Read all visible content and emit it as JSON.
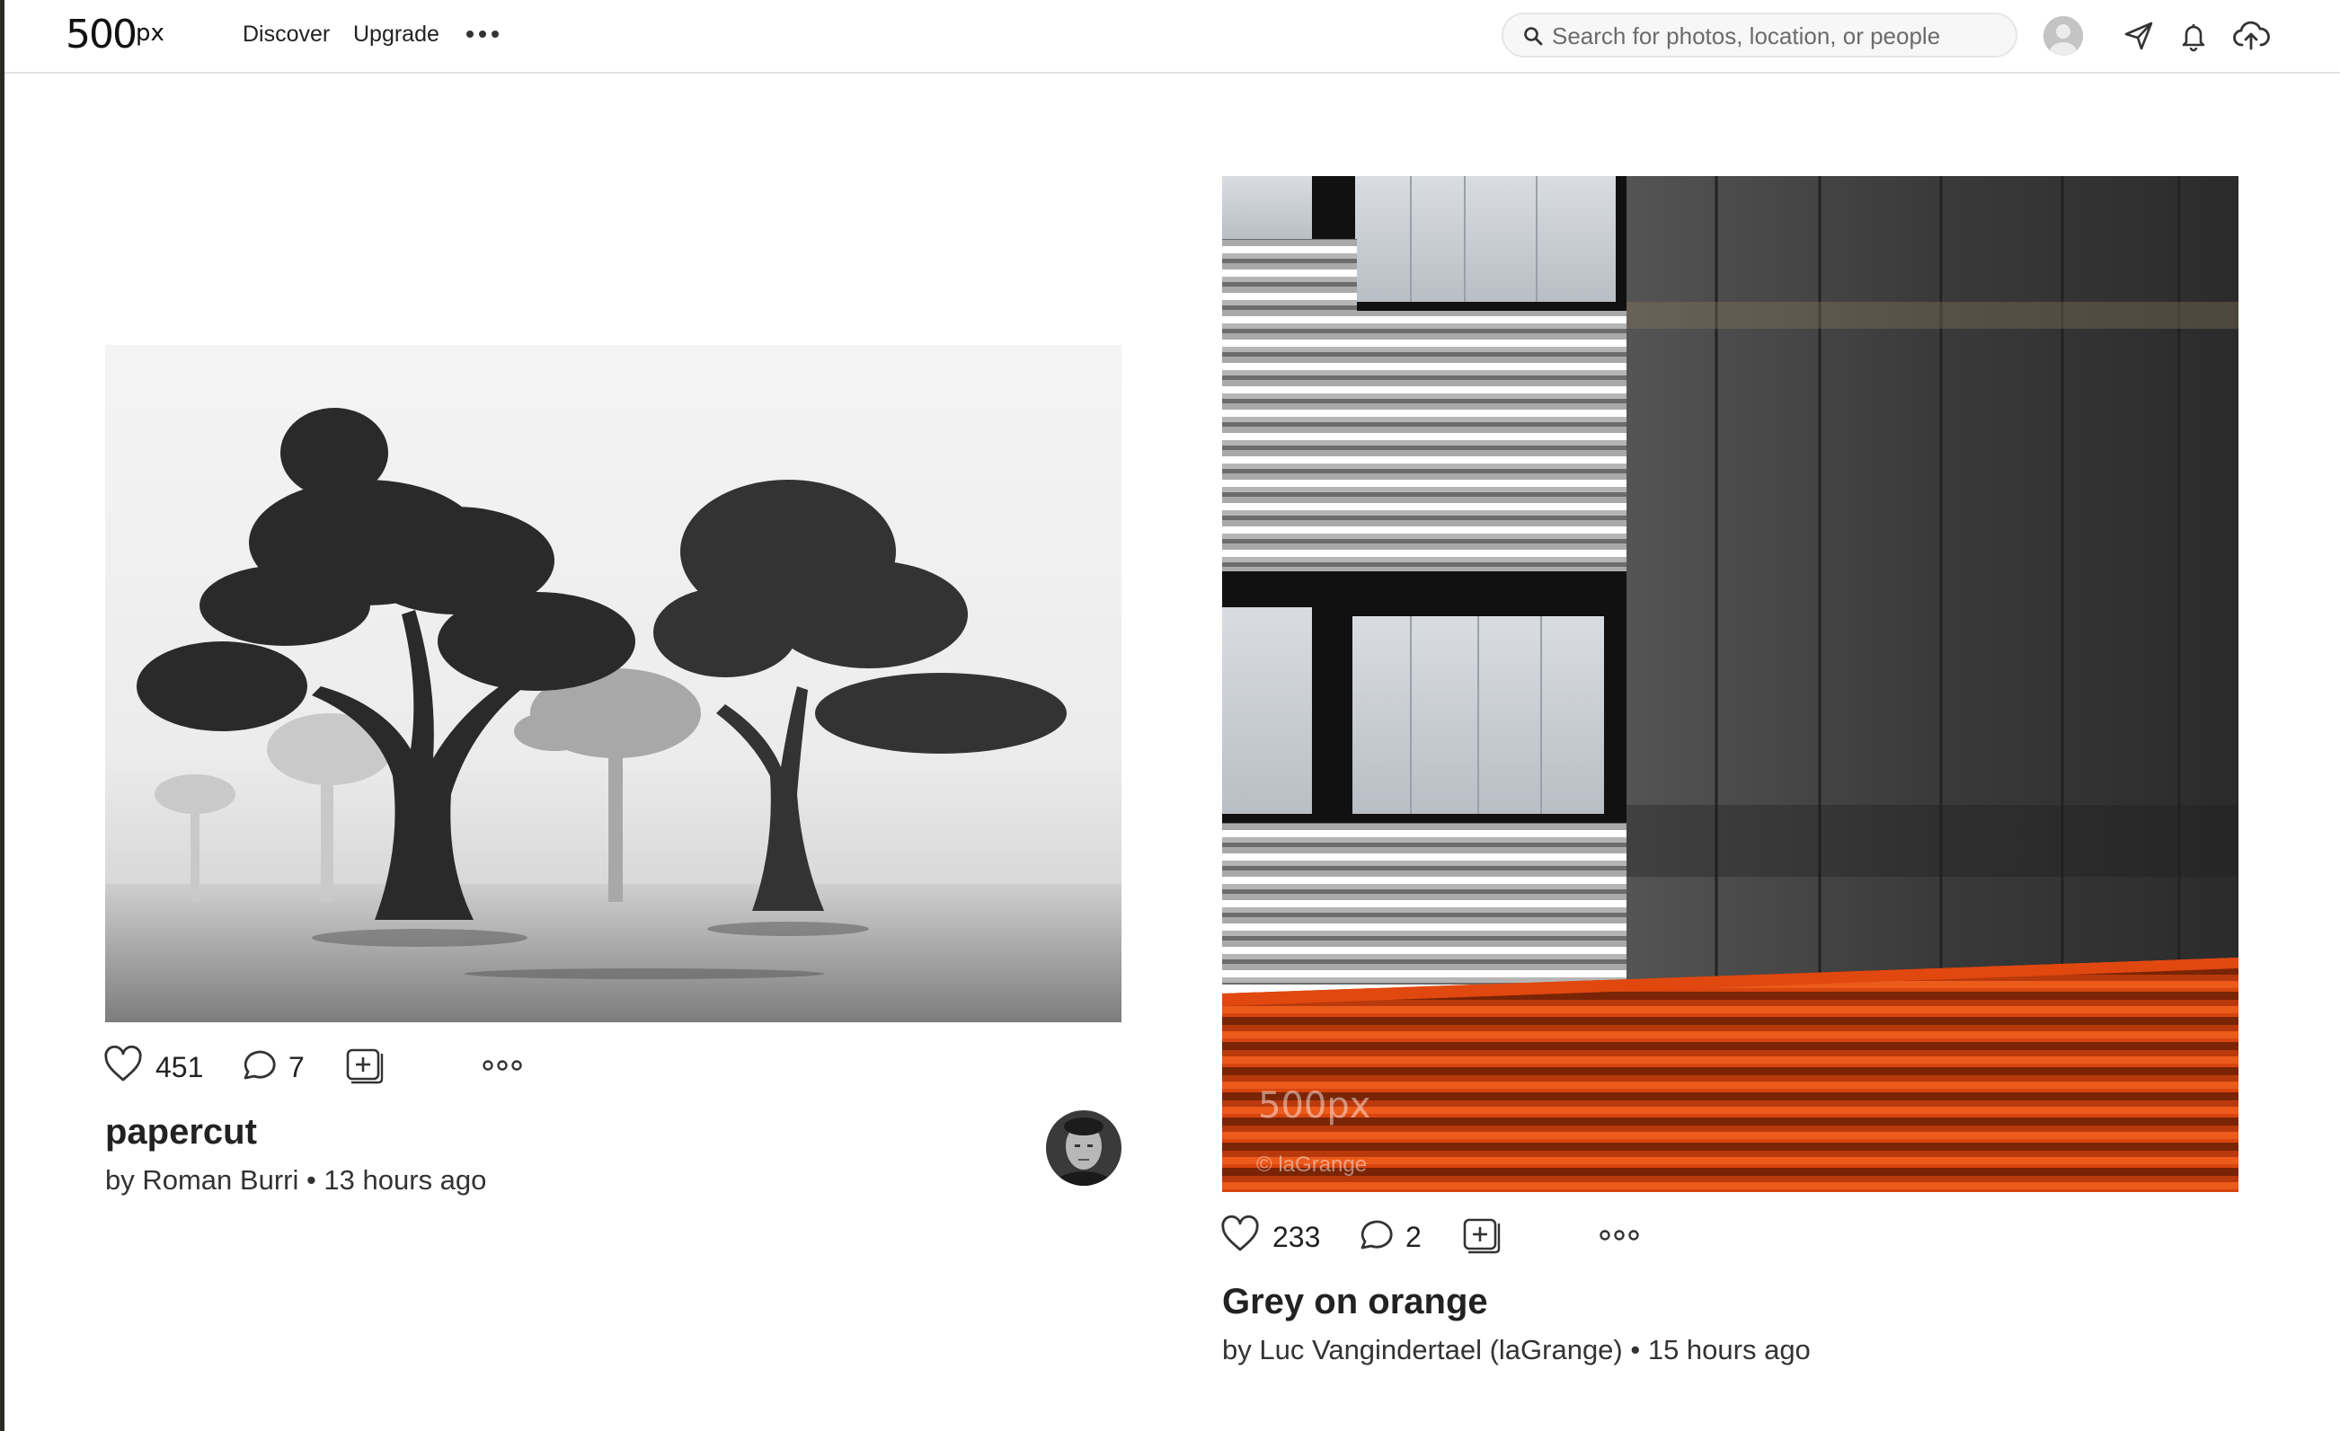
{
  "header": {
    "logo_main": "500",
    "logo_sup": "px",
    "nav": {
      "discover": "Discover",
      "upgrade": "Upgrade"
    },
    "search": {
      "placeholder": "Search for photos, location, or people",
      "value": ""
    }
  },
  "icons": {
    "more": "more-horizontal-icon",
    "search": "search-icon",
    "avatar": "user-avatar",
    "send": "send-icon",
    "notifications": "bell-icon",
    "upload": "cloud-upload-icon",
    "like": "heart-icon",
    "comment": "comment-icon",
    "add_to_gallery": "add-to-gallery-icon"
  },
  "photos": [
    {
      "title": "papercut",
      "byline": "by Roman Burri • 13 hours ago",
      "likes": "451",
      "comments": "7"
    },
    {
      "title": "Grey on orange",
      "byline": "by Luc Vangindertael (laGrange) • 15 hours ago",
      "likes": "233",
      "comments": "2",
      "watermark_logo": "500px",
      "watermark_credit": "© laGrange"
    }
  ],
  "colors": {
    "accent_orange": "#d9450f",
    "text": "#222222"
  }
}
